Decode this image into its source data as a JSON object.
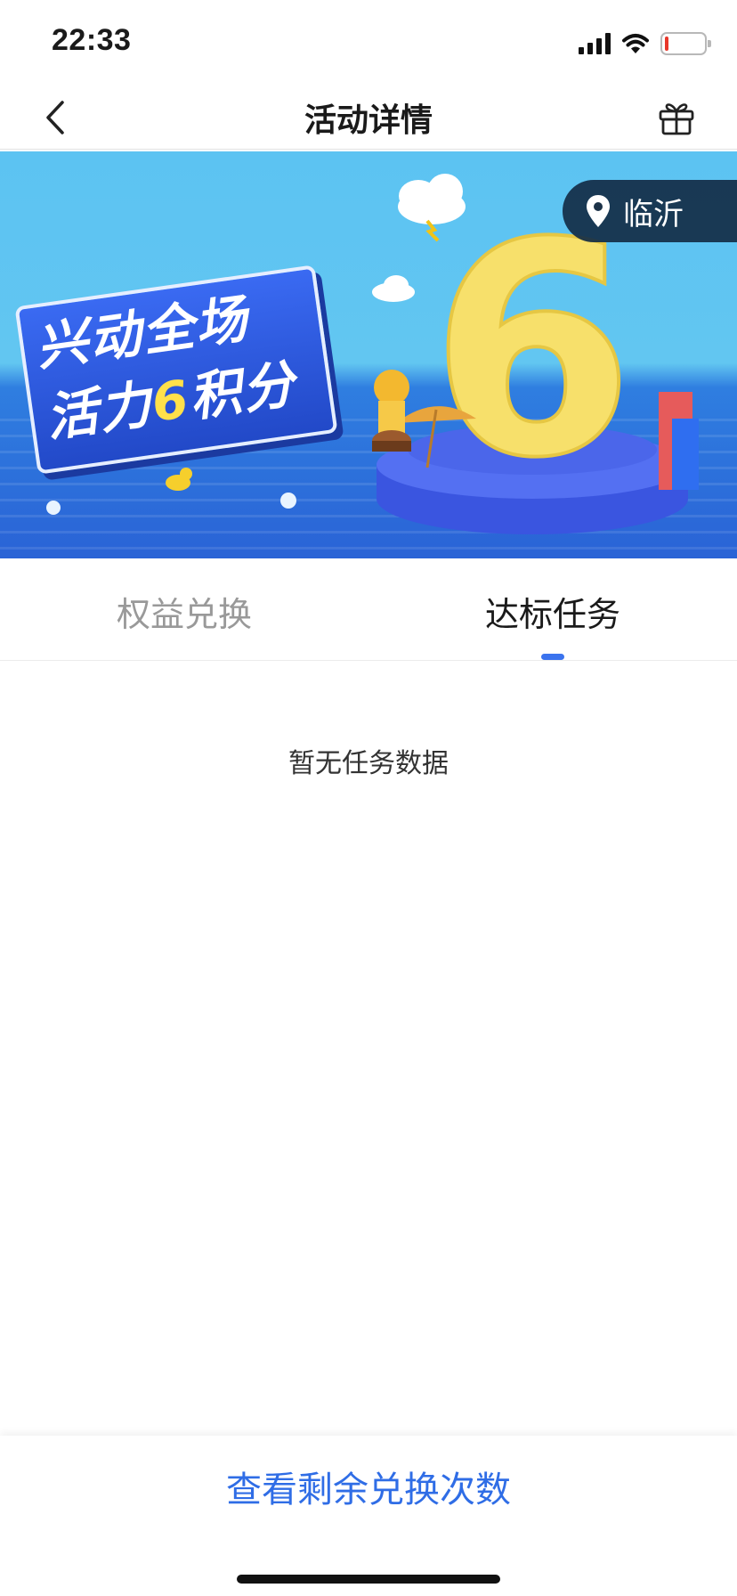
{
  "status_bar": {
    "time": "22:33",
    "battery_level": 0.1,
    "battery_color": "#e8372a"
  },
  "nav": {
    "title": "活动详情",
    "back_icon": "chevron-left-icon",
    "gift_icon": "gift-icon"
  },
  "banner": {
    "location": "临沂",
    "location_icon": "map-pin-icon",
    "slogan_line1": "兴动全场",
    "slogan_line2_prefix": "活力",
    "slogan_number": "6",
    "slogan_line2_suffix": "积分"
  },
  "tabs": [
    {
      "label": "权益兑换",
      "active": false
    },
    {
      "label": "达标任务",
      "active": true
    }
  ],
  "accent_color": "#3b73ee",
  "empty_state": {
    "text": "暂无任务数据"
  },
  "bottom": {
    "action_label": "查看剩余兑换次数"
  }
}
